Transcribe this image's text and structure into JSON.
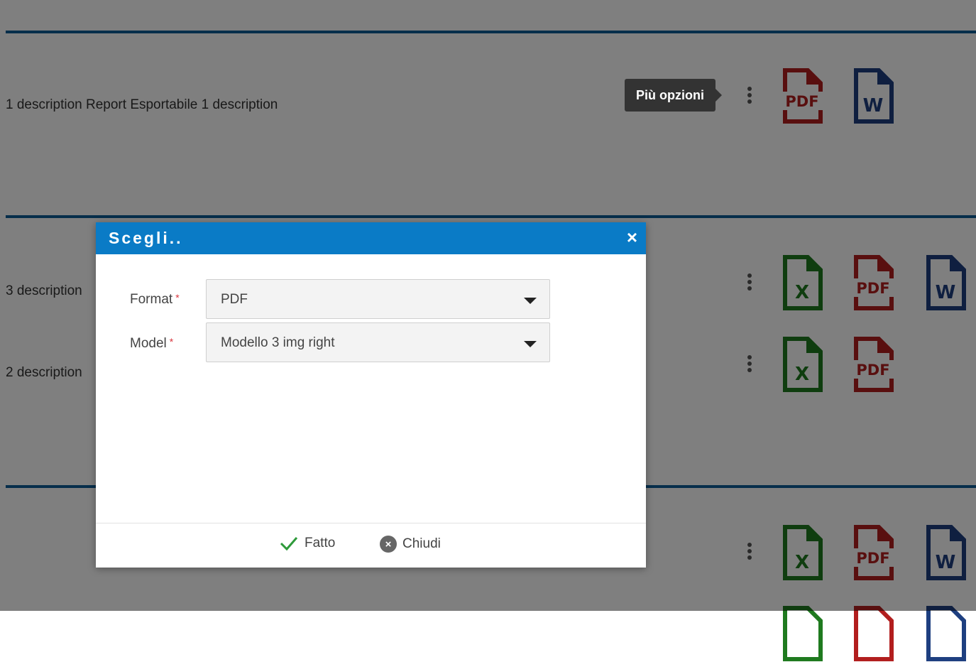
{
  "rows": [
    {
      "description": "1 description Report Esportabile 1 description"
    },
    {
      "description": "3 description"
    },
    {
      "description": "2 description"
    }
  ],
  "tooltip": {
    "text": "Più opzioni"
  },
  "dialog": {
    "title": "Scegli..",
    "close_symbol": "×",
    "fields": [
      {
        "label": "Format",
        "required_mark": "*",
        "value": "PDF"
      },
      {
        "label": "Model",
        "required_mark": "*",
        "value": "Modello 3 img right"
      }
    ],
    "buttons": {
      "done": "Fatto",
      "close": "Chiudi"
    }
  },
  "file_icons": {
    "pdf_label": "PDF",
    "word_label": "W",
    "excel_label": "X",
    "pdf_color": "#b21e1e",
    "word_color": "#1e3f80",
    "excel_color": "#1f7a1f"
  },
  "colors": {
    "separator": "#0c5c96",
    "dialog_header": "#0a7bc6",
    "required": "#d9363e",
    "done_check": "#2e9a3a"
  }
}
